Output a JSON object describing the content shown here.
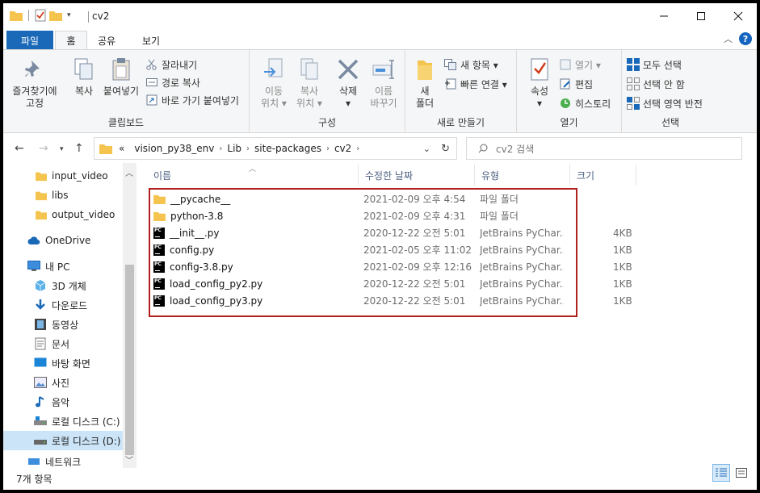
{
  "window": {
    "title": "cv2"
  },
  "tabs": {
    "file": "파일",
    "home": "홈",
    "share": "공유",
    "view": "보기"
  },
  "ribbon": {
    "clipboard": {
      "label": "클립보드",
      "pin": "즐겨찾기에\n고정",
      "copy": "복사",
      "paste": "붙여넣기",
      "cut": "잘라내기",
      "copy_path": "경로 복사",
      "paste_shortcut": "바로 가기 붙여넣기"
    },
    "organize": {
      "label": "구성",
      "move_to": "이동\n위치 ▾",
      "copy_to": "복사\n위치 ▾",
      "delete": "삭제\n▾",
      "rename": "이름\n바꾸기"
    },
    "new": {
      "label": "새로 만들기",
      "new_folder": "새\n폴더",
      "new_item": "새 항목 ▾",
      "easy_access": "빠른 연결 ▾"
    },
    "open": {
      "label": "열기",
      "properties": "속성\n▾",
      "open": "열기 ▾",
      "edit": "편집",
      "history": "히스토리"
    },
    "select": {
      "label": "선택",
      "select_all": "모두 선택",
      "select_none": "선택 안 함",
      "invert": "선택 영역 반전"
    }
  },
  "address": {
    "breadcrumbs": [
      "vision_py38_env",
      "Lib",
      "site-packages",
      "cv2"
    ],
    "prefix": "«",
    "search_placeholder": "cv2 검색"
  },
  "nav": {
    "items": [
      {
        "label": "input_video",
        "icon": "folder"
      },
      {
        "label": "libs",
        "icon": "folder"
      },
      {
        "label": "output_video",
        "icon": "folder"
      },
      {
        "label": "OneDrive",
        "icon": "cloud"
      },
      {
        "label": "내 PC",
        "icon": "pc"
      },
      {
        "label": "3D 개체",
        "icon": "cube"
      },
      {
        "label": "다운로드",
        "icon": "download"
      },
      {
        "label": "동영상",
        "icon": "video"
      },
      {
        "label": "문서",
        "icon": "document"
      },
      {
        "label": "바탕 화면",
        "icon": "desktop"
      },
      {
        "label": "사진",
        "icon": "picture"
      },
      {
        "label": "음악",
        "icon": "music"
      },
      {
        "label": "로컬 디스크 (C:)",
        "icon": "drive"
      },
      {
        "label": "로컬 디스크 (D:)",
        "icon": "drive",
        "selected": true
      },
      {
        "label": "네트워크",
        "icon": "network"
      }
    ]
  },
  "columns": {
    "name": "이름",
    "date": "수정한 날짜",
    "type": "유형",
    "size": "크기"
  },
  "files": [
    {
      "name": "__pycache__",
      "date": "2021-02-09 오후 4:54",
      "type": "파일 폴더",
      "size": "",
      "icon": "folder"
    },
    {
      "name": "python-3.8",
      "date": "2021-02-09 오후 4:31",
      "type": "파일 폴더",
      "size": "",
      "icon": "folder"
    },
    {
      "name": "__init__.py",
      "date": "2020-12-22 오전 5:01",
      "type": "JetBrains PyChar...",
      "size": "4KB",
      "icon": "pycharm"
    },
    {
      "name": "config.py",
      "date": "2021-02-05 오후 11:02",
      "type": "JetBrains PyChar...",
      "size": "1KB",
      "icon": "pycharm"
    },
    {
      "name": "config-3.8.py",
      "date": "2021-02-09 오후 12:16",
      "type": "JetBrains PyChar...",
      "size": "1KB",
      "icon": "pycharm"
    },
    {
      "name": "load_config_py2.py",
      "date": "2020-12-22 오전 5:01",
      "type": "JetBrains PyChar...",
      "size": "1KB",
      "icon": "pycharm"
    },
    {
      "name": "load_config_py3.py",
      "date": "2020-12-22 오전 5:01",
      "type": "JetBrains PyChar...",
      "size": "1KB",
      "icon": "pycharm"
    }
  ],
  "status": {
    "count": "7개 항목"
  },
  "colors": {
    "accent": "#1a69b8",
    "highlight_box": "#b01e1e",
    "folder": "#f4c44e"
  }
}
